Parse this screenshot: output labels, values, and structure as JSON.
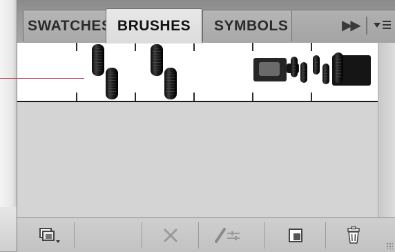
{
  "tabs": [
    {
      "label": "SWATCHES"
    },
    {
      "label": "BRUSHES",
      "active": true
    },
    {
      "label": "SYMBOLS"
    }
  ],
  "icons": {
    "fast_forward": "fast-forward-icon",
    "panel_menu": "panel-menu-icon",
    "brush_libraries": "brush-libraries-menu-icon",
    "remove_stroke": "remove-brush-stroke-icon",
    "options": "options-of-selected-object-icon",
    "new_brush": "new-brush-icon",
    "delete": "delete-brush-icon"
  },
  "colors": {
    "accent_line": "#c0405a"
  }
}
